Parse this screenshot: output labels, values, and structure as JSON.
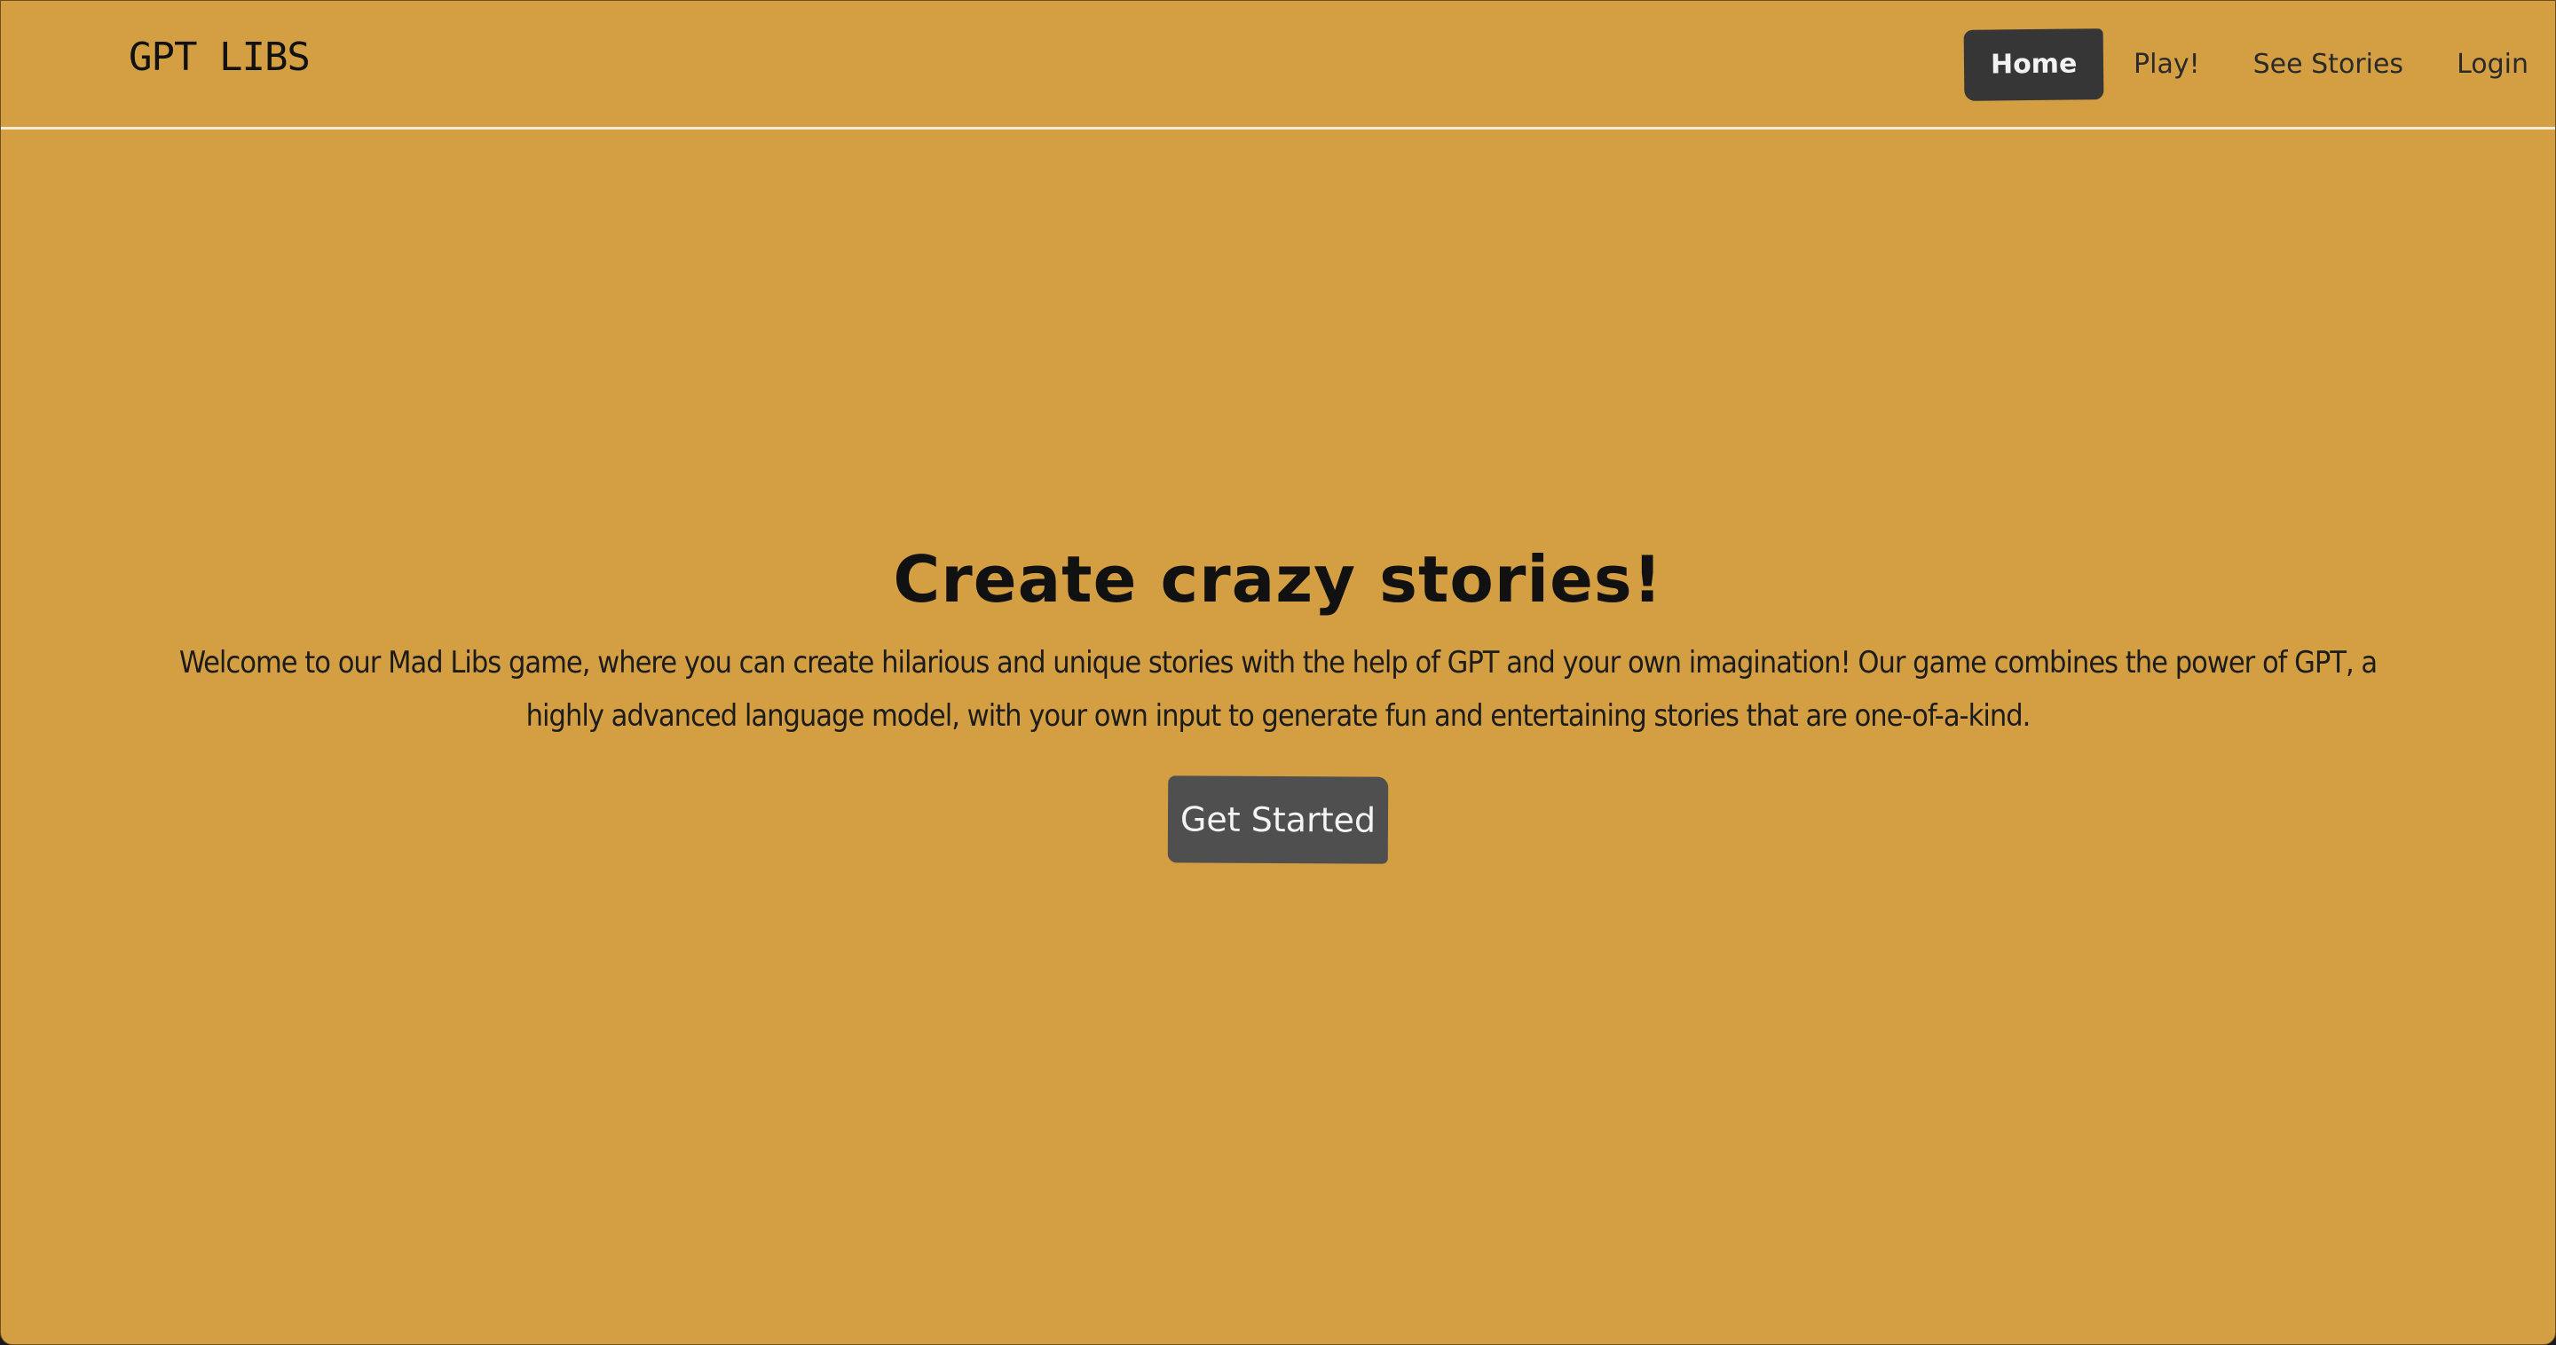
{
  "navbar": {
    "brand": "GPT LIBS",
    "items": [
      {
        "label": "Home",
        "active": true
      },
      {
        "label": "Play!",
        "active": false
      },
      {
        "label": "See Stories",
        "active": false
      },
      {
        "label": "Login",
        "active": false
      }
    ]
  },
  "hero": {
    "title": "Create crazy stories!",
    "description": "Welcome to our Mad Libs game, where you can create hilarious and unique stories with the help of GPT and your own imagination! Our game combines the power of GPT, a highly advanced language model, with your own input to generate fun and entertaining stories that are one-of-a-kind.",
    "cta_label": "Get Started"
  },
  "colors": {
    "background": "#d49f42",
    "nav_active": "#363636",
    "button": "#4f4f4f"
  }
}
